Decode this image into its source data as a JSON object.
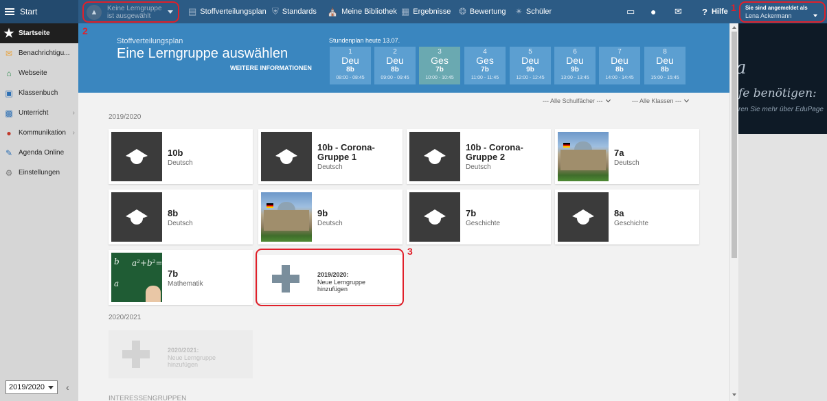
{
  "topbar": {
    "menu_label": "Start",
    "learning_group_select": {
      "line1": "Keine Lerngruppe",
      "line2": "ist ausgewählt"
    },
    "nav": [
      {
        "label": "Stoffverteilungsplan",
        "icon": "table-icon"
      },
      {
        "label": "Standards",
        "icon": "shield-icon"
      },
      {
        "label": "Meine Bibliothek",
        "icon": "library-icon"
      },
      {
        "label": "Ergebnisse",
        "icon": "bar-chart-icon"
      },
      {
        "label": "Bewertung",
        "icon": "badge-icon"
      },
      {
        "label": "Schüler",
        "icon": "students-icon"
      }
    ],
    "help_label": "Hilfe"
  },
  "account": {
    "label": "Sie sind angemeldet als",
    "name": "Lena Ackermann"
  },
  "side_panel": {
    "line1": "a",
    "line2": "fe benötigen:",
    "line3": "ren Sie mehr über EduPage"
  },
  "annotations": {
    "one": "1",
    "two": "2",
    "three": "3"
  },
  "sidebar": {
    "items": [
      {
        "label": "Startseite",
        "icon": "star-icon"
      },
      {
        "label": "Benachrichtigu...",
        "icon": "envelope-icon"
      },
      {
        "label": "Webseite",
        "icon": "home-icon"
      },
      {
        "label": "Klassenbuch",
        "icon": "book-icon"
      },
      {
        "label": "Unterricht",
        "icon": "classroom-icon"
      },
      {
        "label": "Kommunikation",
        "icon": "chat-icon"
      },
      {
        "label": "Agenda Online",
        "icon": "pen-icon"
      },
      {
        "label": "Einstellungen",
        "icon": "gear-icon"
      }
    ],
    "year_select": "2019/2020"
  },
  "hero": {
    "subtitle": "Stoffverteilungsplan",
    "title": "Eine Lerngruppe auswählen",
    "more_link": "WEITERE INFORMATIONEN",
    "schedule_label": "Stundenplan heute 13.07.",
    "slots": [
      {
        "num": "1",
        "subject": "Deu",
        "class": "8b",
        "time": "08:00 - 08:45"
      },
      {
        "num": "2",
        "subject": "Deu",
        "class": "8b",
        "time": "09:00 - 09:45"
      },
      {
        "num": "3",
        "subject": "Ges",
        "class": "7b",
        "time": "10:00 - 10:45"
      },
      {
        "num": "4",
        "subject": "Ges",
        "class": "7b",
        "time": "11:00 - 11:45"
      },
      {
        "num": "5",
        "subject": "Deu",
        "class": "9b",
        "time": "12:00 - 12:45"
      },
      {
        "num": "6",
        "subject": "Deu",
        "class": "9b",
        "time": "13:00 - 13:45"
      },
      {
        "num": "7",
        "subject": "Deu",
        "class": "8b",
        "time": "14:00 - 14:45"
      },
      {
        "num": "8",
        "subject": "Deu",
        "class": "8b",
        "time": "15:00 - 15:45"
      }
    ]
  },
  "filters": {
    "subjects": "--- Alle Schulfächer ---",
    "classes": "--- Alle Klassen ---"
  },
  "sections": [
    {
      "year": "2019/2020",
      "groups": [
        {
          "name": "10b",
          "subject": "Deutsch",
          "thumb": "cap"
        },
        {
          "name": "10b - Corona-Gruppe 1",
          "subject": "Deutsch",
          "thumb": "cap"
        },
        {
          "name": "10b - Corona-Gruppe 2",
          "subject": "Deutsch",
          "thumb": "cap"
        },
        {
          "name": "7a",
          "subject": "Deutsch",
          "thumb": "reichstag"
        },
        {
          "name": "8b",
          "subject": "Deutsch",
          "thumb": "cap"
        },
        {
          "name": "9b",
          "subject": "Deutsch",
          "thumb": "reichstag"
        },
        {
          "name": "7b",
          "subject": "Geschichte",
          "thumb": "cap"
        },
        {
          "name": "8a",
          "subject": "Geschichte",
          "thumb": "cap"
        },
        {
          "name": "7b",
          "subject": "Mathematik",
          "thumb": "math"
        }
      ],
      "add": {
        "line1": "2019/2020:",
        "line2": "Neue Lerngruppe hinzufügen"
      }
    },
    {
      "year": "2020/2021",
      "add": {
        "line1": "2020/2021:",
        "line2": "Neue Lerngruppe hinzufügen"
      }
    }
  ],
  "next_section_peek": "INTERESSENGRUPPEN",
  "colors": {
    "topbar": "#2c5b85",
    "hero": "#3a86bf",
    "slot": "#5c9fd1",
    "slot_current": "#6aa9b1",
    "annotation": "#e0202a"
  }
}
